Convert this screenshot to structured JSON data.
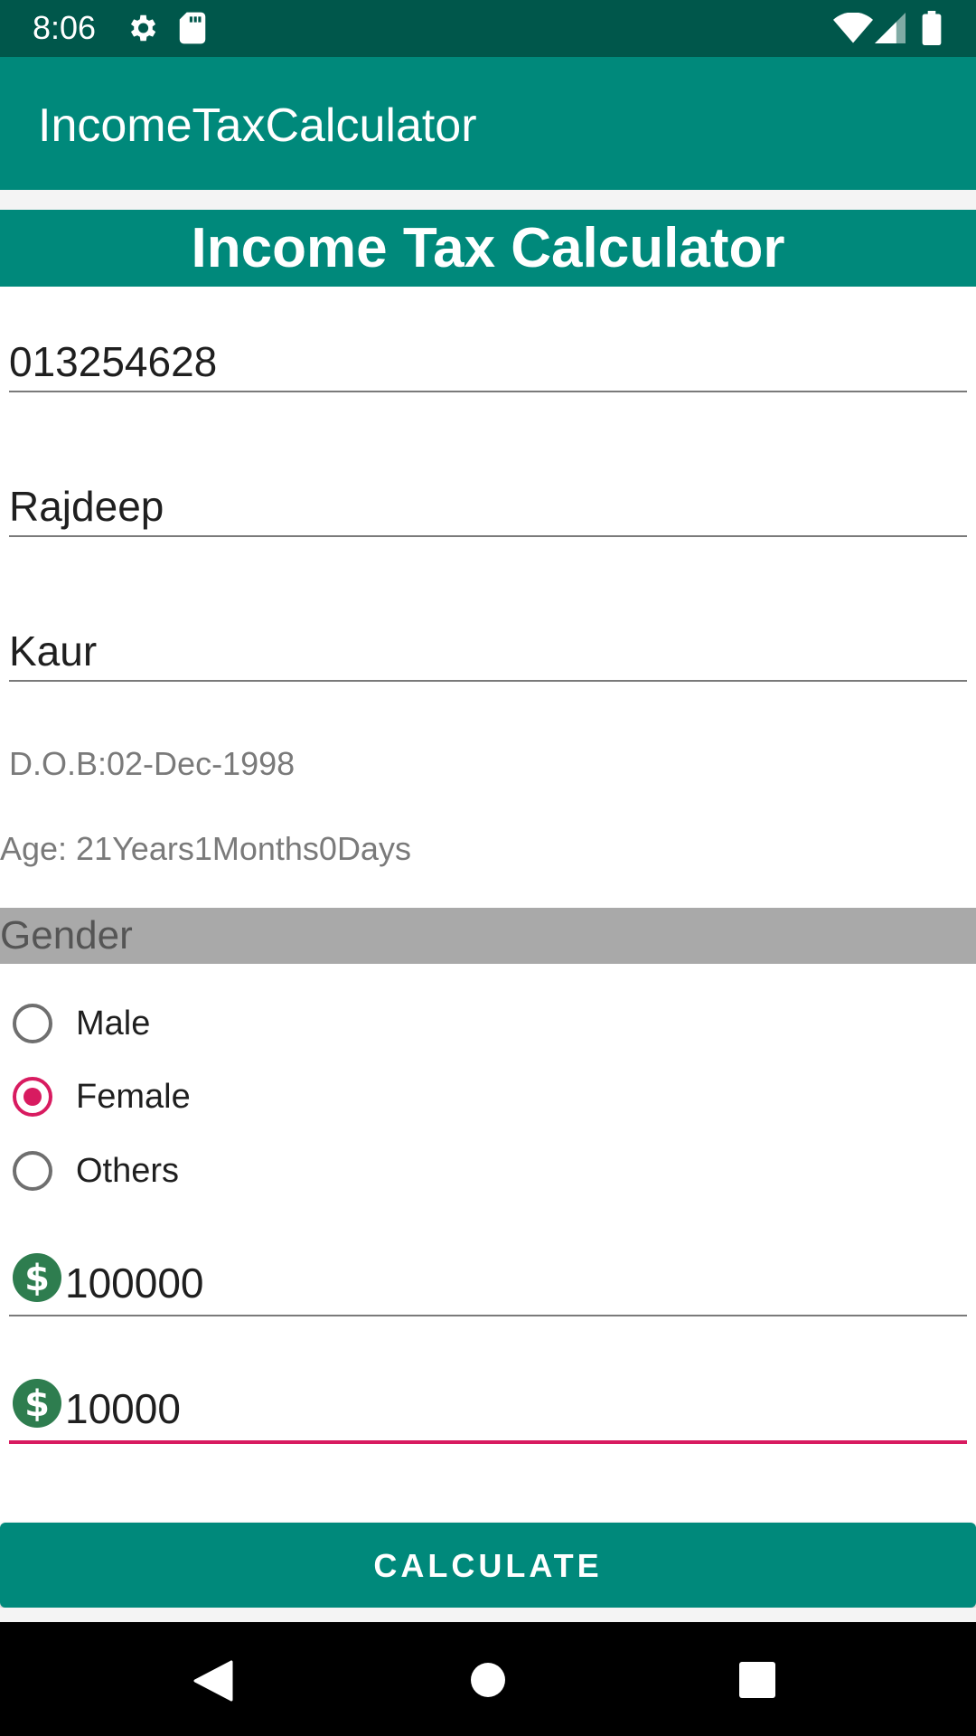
{
  "status_bar": {
    "time": "8:06",
    "icons": [
      "settings-icon",
      "sd-card-icon",
      "wifi-icon",
      "signal-icon",
      "battery-icon"
    ]
  },
  "app_bar": {
    "title": "IncomeTaxCalculator"
  },
  "form": {
    "heading": "Income Tax Calculator",
    "sin": "013254628",
    "first_name": "Rajdeep",
    "last_name": "Kaur",
    "dob": "D.O.B:02-Dec-1998",
    "age": "Age: 21Years1Months0Days",
    "gender_label": "Gender",
    "gender_options": [
      {
        "label": "Male",
        "checked": false
      },
      {
        "label": "Female",
        "checked": true
      },
      {
        "label": "Others",
        "checked": false
      }
    ],
    "gross_income": "100000",
    "rrsp": "10000",
    "calculate_label": "CALCULATE"
  },
  "colors": {
    "primary": "#00897b",
    "primary_dark": "#00574b",
    "accent": "#d81b60",
    "dollar_icon": "#2e7d4f"
  }
}
